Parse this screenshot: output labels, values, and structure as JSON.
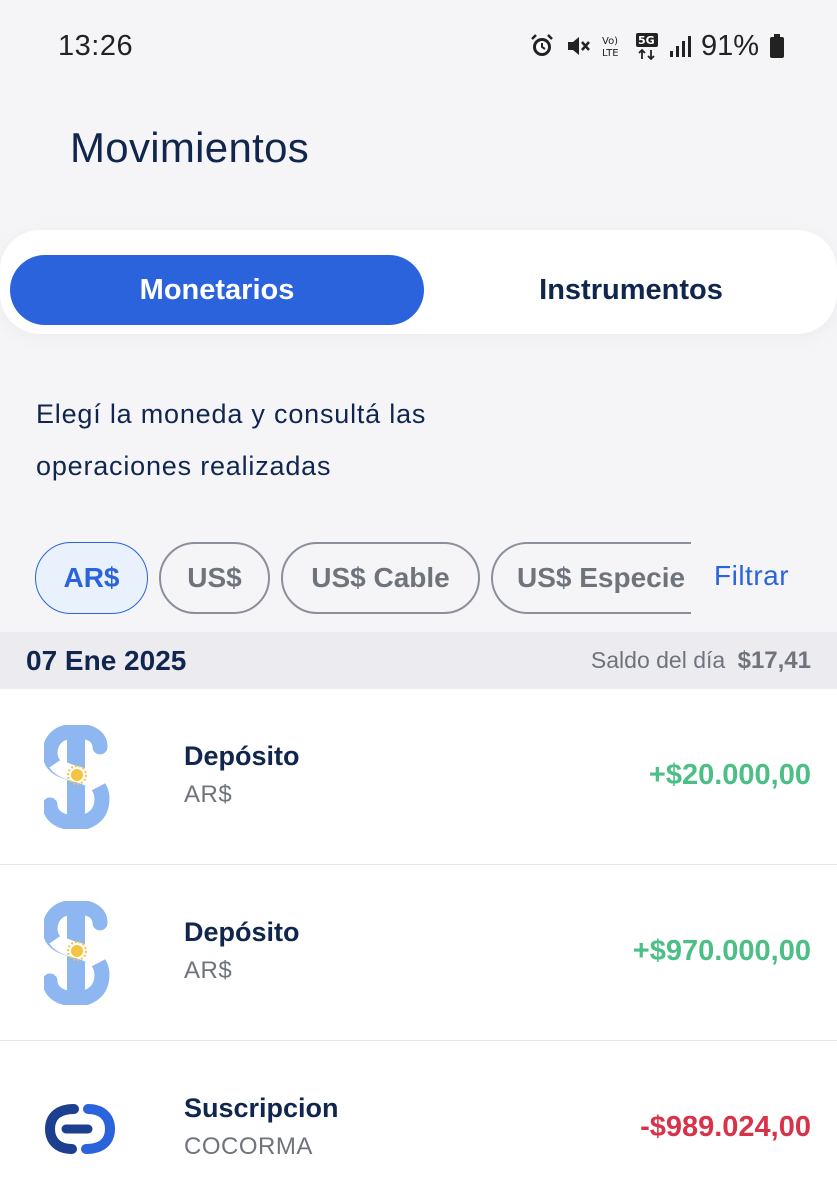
{
  "status_bar": {
    "time": "13:26",
    "battery": "91%",
    "icons": [
      "alarm-icon",
      "mute-icon",
      "volte-icon",
      "5g-icon",
      "signal-icon",
      "battery-icon"
    ]
  },
  "header": {
    "title": "Movimientos"
  },
  "tabs": [
    {
      "label": "Monetarios",
      "active": true
    },
    {
      "label": "Instrumentos",
      "active": false
    }
  ],
  "intro": {
    "line1": "Elegí la moneda y consultá las",
    "line2": "operaciones realizadas"
  },
  "currency_chips": [
    {
      "label": "AR$",
      "active": true
    },
    {
      "label": "US$",
      "active": false
    },
    {
      "label": "US$ Cable",
      "active": false
    },
    {
      "label": "US$ Especie",
      "active": false
    }
  ],
  "filter_label": "Filtrar",
  "day_group": {
    "date": "07 Ene 2025",
    "balance_label": "Saldo del día",
    "balance_value": "$17,41"
  },
  "transactions": [
    {
      "title": "Depósito",
      "subtitle": "AR$",
      "amount": "+$20.000,00",
      "type": "credit",
      "icon": "peso-flag-icon"
    },
    {
      "title": "Depósito",
      "subtitle": "AR$",
      "amount": "+$970.000,00",
      "type": "credit",
      "icon": "peso-flag-icon"
    },
    {
      "title": "Suscripcion",
      "subtitle": "COCORMA",
      "amount": "-$989.024,00",
      "type": "debit",
      "icon": "subscription-icon"
    }
  ],
  "colors": {
    "accent": "#2a63dc",
    "title": "#11264e",
    "credit": "#4bbf85",
    "debit": "#d9334a"
  }
}
